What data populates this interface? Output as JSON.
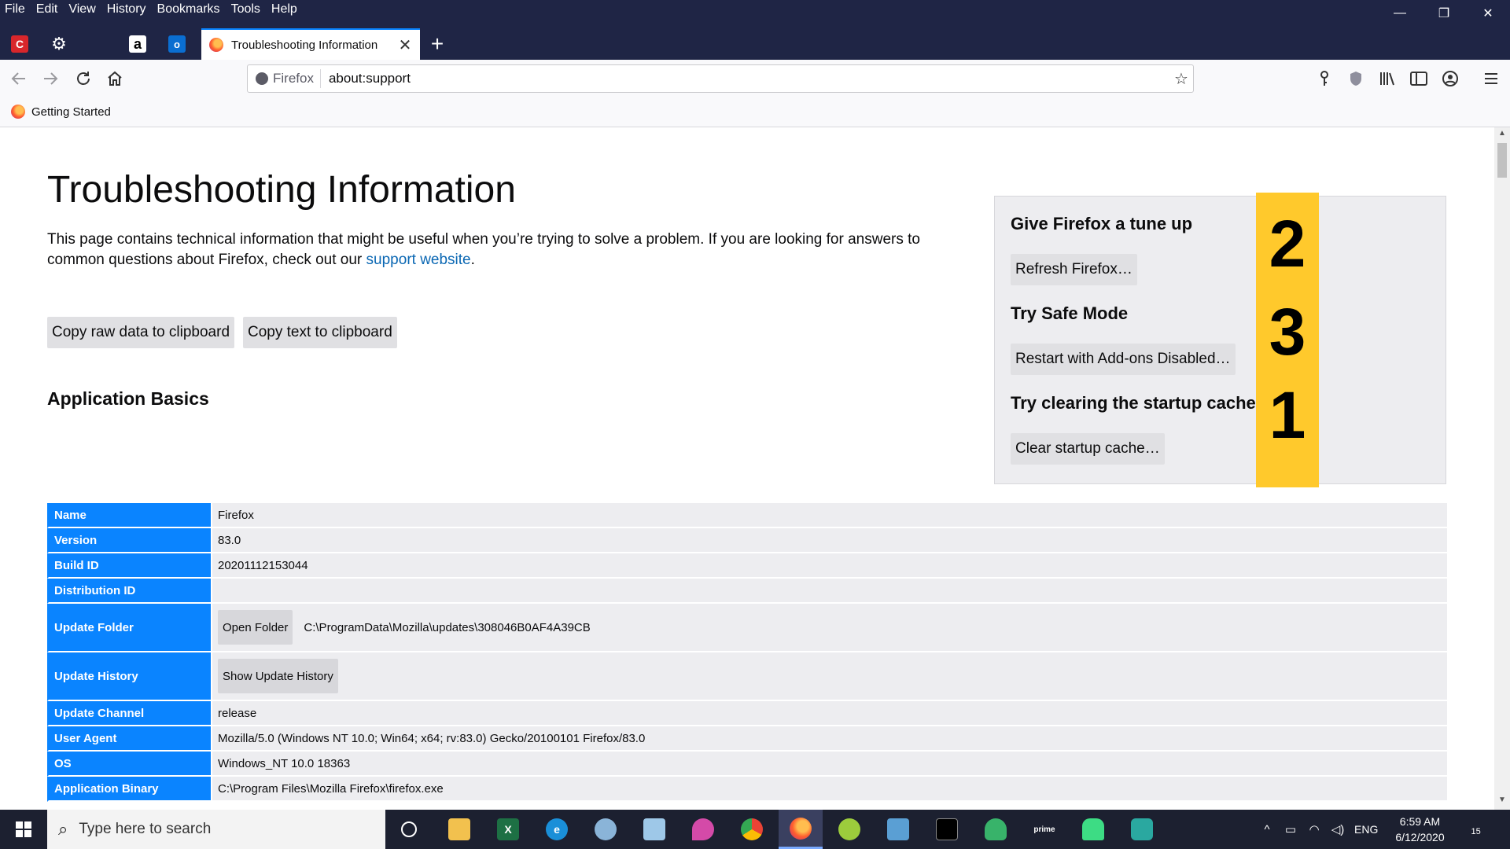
{
  "menubar": {
    "items": [
      "File",
      "Edit",
      "View",
      "History",
      "Bookmarks",
      "Tools",
      "Help"
    ]
  },
  "window_controls": {
    "minimize": "—",
    "restore": "❐",
    "close": "✕"
  },
  "tabs": {
    "active_title": "Troubleshooting Information",
    "close_glyph": "✕",
    "new_tab_glyph": "+"
  },
  "navbar": {
    "identity_label": "Firefox",
    "url": "about:support"
  },
  "bookmarks": {
    "items": [
      "Getting Started"
    ]
  },
  "page": {
    "title": "Troubleshooting Information",
    "intro_text": "This page contains technical information that might be useful when you’re trying to solve a problem. If you are looking for answers to common questions about Firefox, check out our ",
    "support_link": "support website",
    "intro_end": ".",
    "copy_raw_button": "Copy raw data to clipboard",
    "copy_text_button": "Copy text to clipboard",
    "app_basics_heading": "Application Basics"
  },
  "reset_box": {
    "tune_up_heading": "Give Firefox a tune up",
    "refresh_button": "Refresh Firefox…",
    "safe_mode_heading": "Try Safe Mode",
    "safe_mode_button": "Restart with Add-ons Disabled…",
    "startup_cache_heading": "Try clearing the startup cache",
    "startup_cache_button": "Clear startup cache…"
  },
  "annotations": {
    "numbers": [
      "2",
      "3",
      "1"
    ],
    "strip_color": "#ffc92c"
  },
  "basics_table": {
    "rows": [
      {
        "label": "Name",
        "value": "Firefox"
      },
      {
        "label": "Version",
        "value": "83.0"
      },
      {
        "label": "Build ID",
        "value": "20201112153044"
      },
      {
        "label": "Distribution ID",
        "value": ""
      },
      {
        "label": "Update Folder",
        "button": "Open Folder",
        "value": "C:\\ProgramData\\Mozilla\\updates\\308046B0AF4A39CB"
      },
      {
        "label": "Update History",
        "button": "Show Update History",
        "value": ""
      },
      {
        "label": "Update Channel",
        "value": "release"
      },
      {
        "label": "User Agent",
        "value": "Mozilla/5.0 (Windows NT 10.0; Win64; x64; rv:83.0) Gecko/20100101 Firefox/83.0"
      },
      {
        "label": "OS",
        "value": "Windows_NT 10.0 18363"
      },
      {
        "label": "Application Binary",
        "value": "C:\\Program Files\\Mozilla Firefox\\firefox.exe"
      }
    ]
  },
  "taskbar": {
    "search_placeholder": "Type here to search",
    "tray_language": "ENG",
    "time": "6:59 AM",
    "date": "6/12/2020",
    "notification_count": "15",
    "apps": [
      "cortana-icon",
      "file-explorer-icon",
      "excel-icon",
      "edge-icon",
      "paint-icon",
      "notes-icon",
      "drop-icon",
      "chrome-icon",
      "firefox-icon",
      "android-icon",
      "control-panel-icon",
      "terminal-icon",
      "keepass-icon",
      "prime-video-icon",
      "android-robot-icon",
      "vpn-shield-icon"
    ]
  },
  "colors": {
    "accent": "#0a84ff",
    "titlebar": "#1f2545",
    "link": "#0a67b3"
  }
}
